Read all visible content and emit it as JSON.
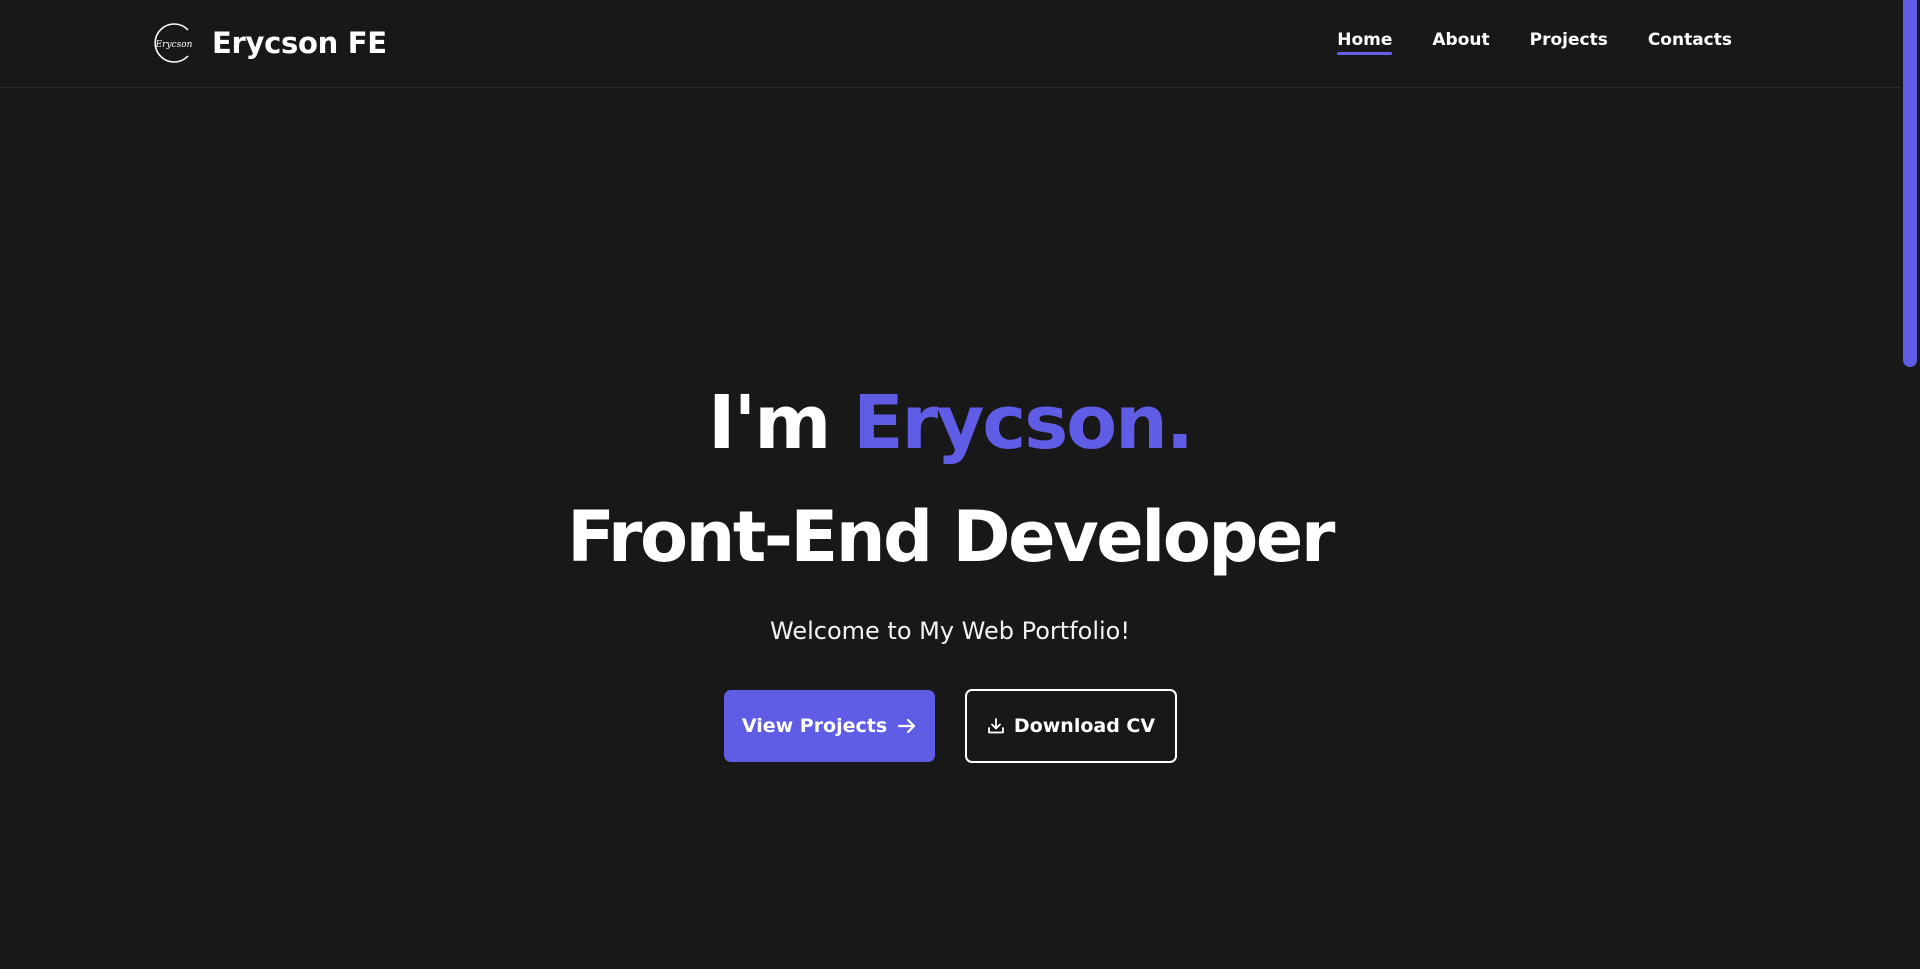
{
  "brand": {
    "logo_text": "Erycson",
    "name": "Erycson FE"
  },
  "nav": {
    "items": [
      {
        "label": "Home",
        "active": true
      },
      {
        "label": "About",
        "active": false
      },
      {
        "label": "Projects",
        "active": false
      },
      {
        "label": "Contacts",
        "active": false
      }
    ]
  },
  "hero": {
    "greeting_prefix": "I'm ",
    "greeting_name": "Erycson.",
    "role": "Front-End Developer",
    "welcome": "Welcome to My Web Portfolio!"
  },
  "actions": {
    "view_projects": {
      "label": "View Projects",
      "icon": "arrow-right-icon"
    },
    "download_cv": {
      "label": "Download CV",
      "icon": "download-icon"
    }
  },
  "colors": {
    "background": "#181818",
    "accent": "#5f5ce6",
    "text": "#ffffff"
  }
}
